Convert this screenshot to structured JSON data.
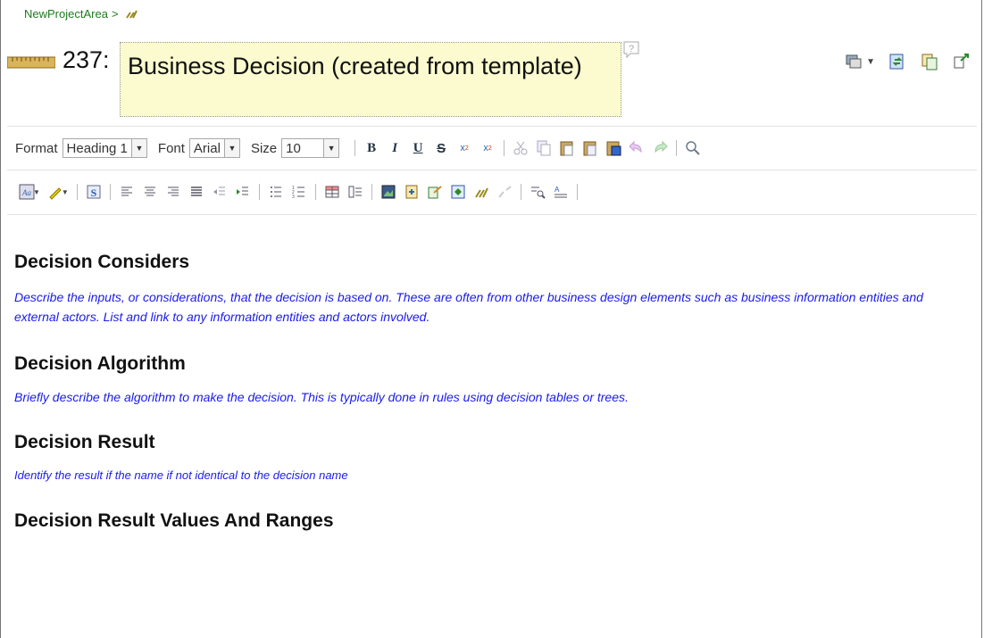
{
  "breadcrumb": {
    "project": "NewProjectArea",
    "separator": ">"
  },
  "header": {
    "id": "237:",
    "title": "Business Decision (created from template)",
    "help_icon": "help-icon",
    "actions": [
      "presentation-icon",
      "sync-icon",
      "copy-icon",
      "link-icon"
    ]
  },
  "toolbar": {
    "format_label": "Format",
    "format_value": "Heading 1",
    "font_label": "Font",
    "font_value": "Arial",
    "size_label": "Size",
    "size_value": "10",
    "bold": "B",
    "italic": "I",
    "underline": "U",
    "strike": "S",
    "subscript": "x",
    "superscript": "x"
  },
  "sections": [
    {
      "heading": "Decision Considers",
      "text": "Describe the inputs, or considerations, that the decision is based on. These are often from other business design elements such as business information entities and external actors. List and link to any information entities and actors involved."
    },
    {
      "heading": "Decision Algorithm",
      "text": "Briefly describe the algorithm to make the decision. This is typically done in rules using decision tables or trees."
    },
    {
      "heading": "Decision Result",
      "text": "Identify the result if the name if not identical to the decision name"
    },
    {
      "heading": "Decision Result Values And Ranges",
      "text": ""
    }
  ],
  "colors": {
    "breadcrumb": "#1f7a1f",
    "title_bg": "#fbfbcf",
    "body_text": "#1a1af0"
  }
}
